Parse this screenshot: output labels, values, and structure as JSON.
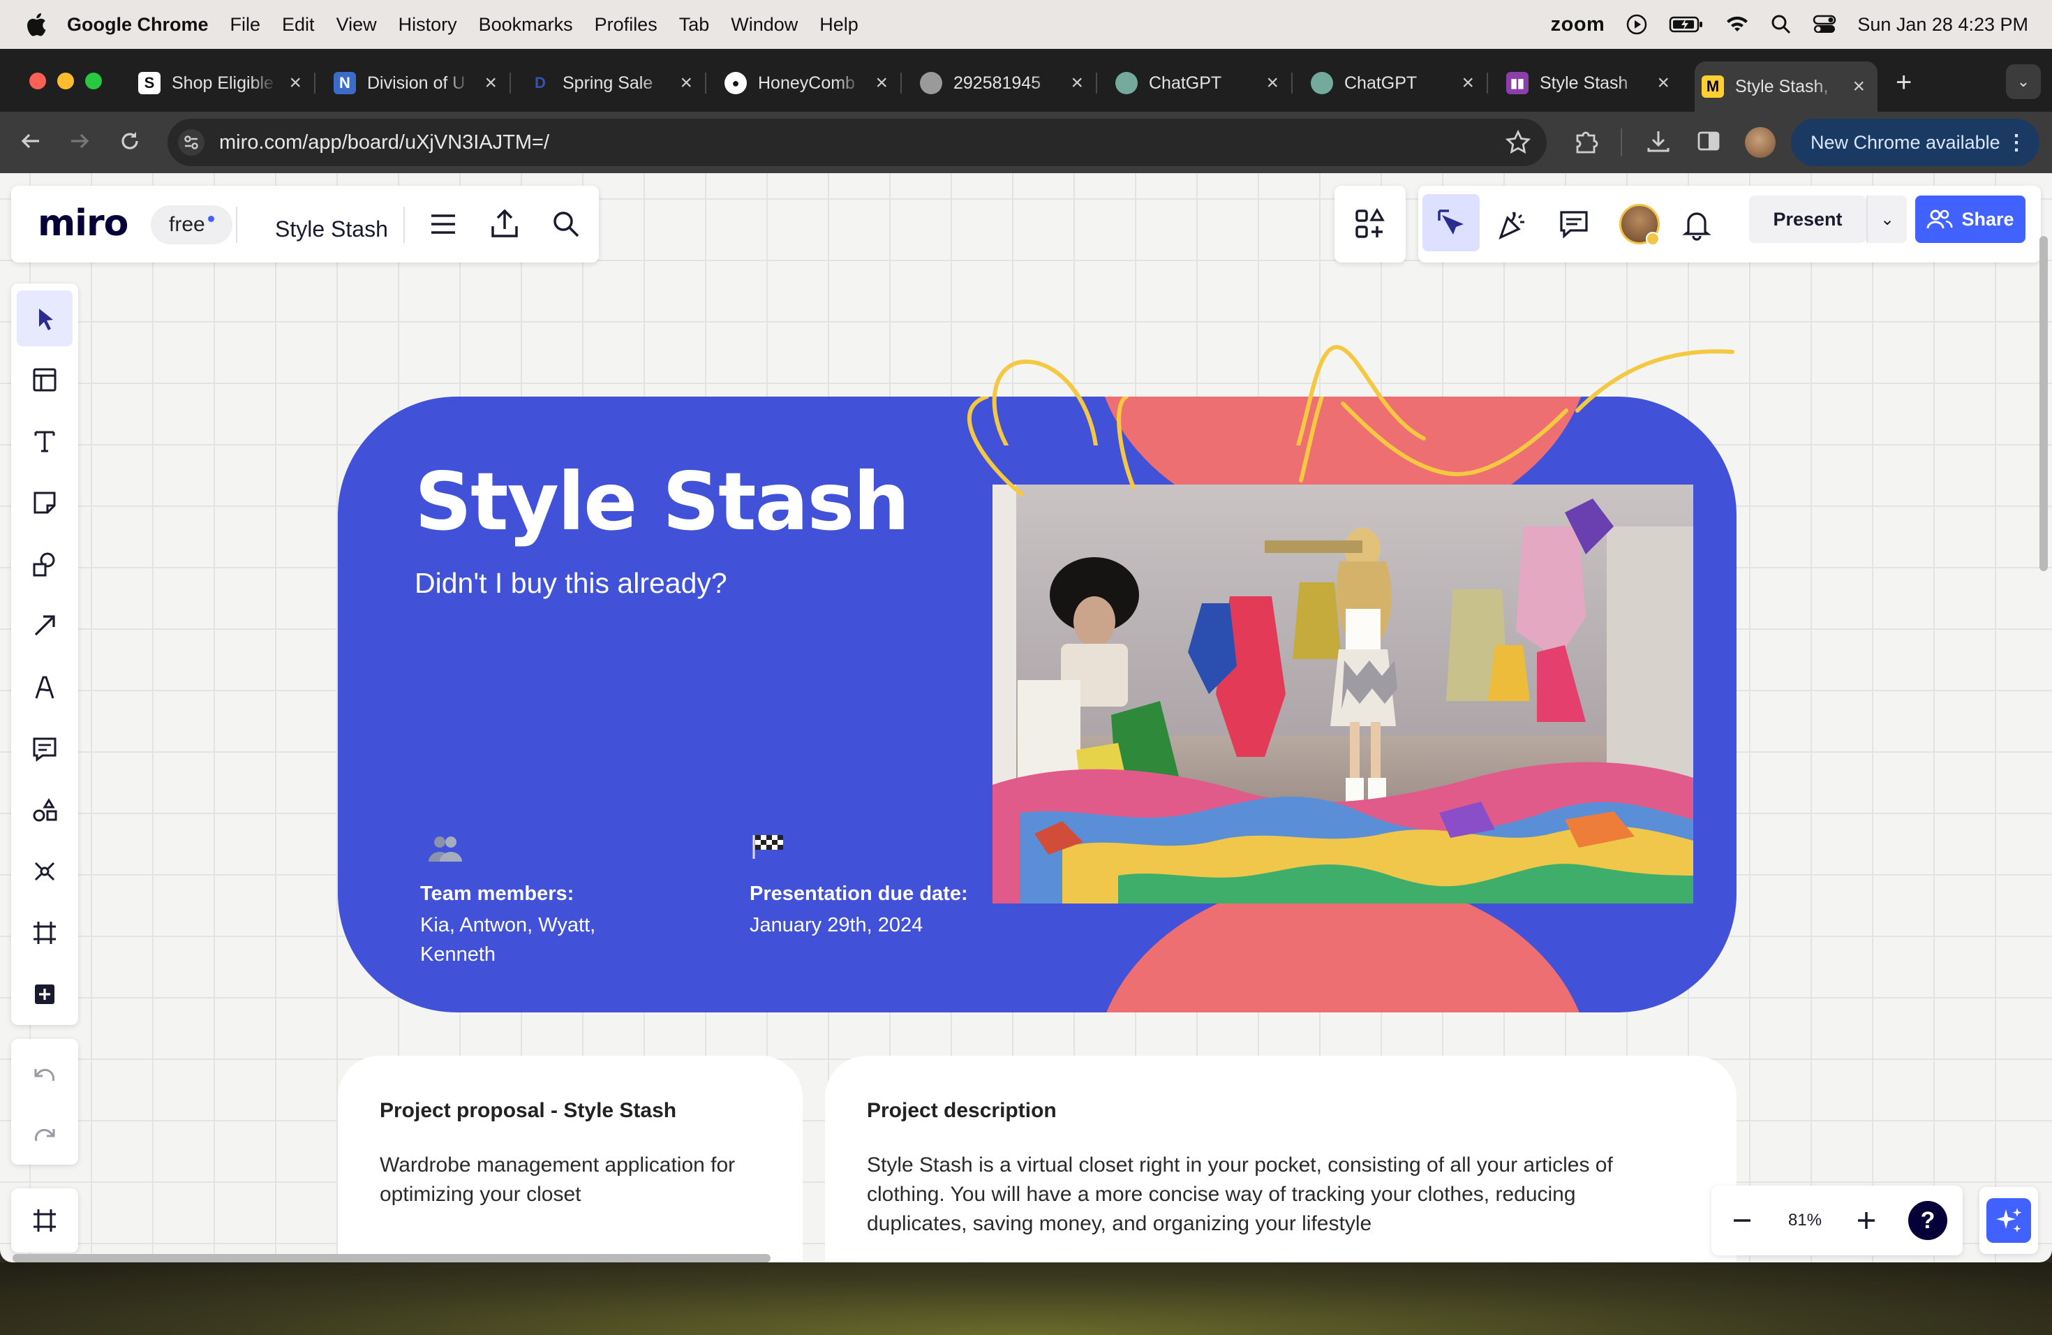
{
  "menubar": {
    "app_name": "Google Chrome",
    "items": [
      "File",
      "Edit",
      "View",
      "History",
      "Bookmarks",
      "Profiles",
      "Tab",
      "Window",
      "Help"
    ],
    "zoom_label": "zoom",
    "datetime": "Sun Jan 28  4:23 PM"
  },
  "browser": {
    "tabs": [
      {
        "title": "Shop Eligible",
        "favicon": "S",
        "color": "#ffffff"
      },
      {
        "title": "Division of U",
        "favicon": "N",
        "color": "#3b6cc8"
      },
      {
        "title": "Spring Sale",
        "favicon": "D",
        "color": "#1c3f8f"
      },
      {
        "title": "HoneyComb",
        "favicon": "gh",
        "color": "#ffffff"
      },
      {
        "title": "292581945",
        "favicon": "w",
        "color": "#9a9a9a"
      },
      {
        "title": "ChatGPT",
        "favicon": "ai",
        "color": "#74aa9c"
      },
      {
        "title": "ChatGPT",
        "favicon": "ai",
        "color": "#74aa9c"
      },
      {
        "title": "Style Stash",
        "favicon": "t",
        "color": "#8b3fa8"
      },
      {
        "title": "Style Stash,",
        "favicon": "m",
        "color": "#ffd02f"
      }
    ],
    "url": "miro.com/app/board/uXjVN3IAJTM=/",
    "update_button": "New Chrome available"
  },
  "miro": {
    "logo": "miro",
    "plan_badge": "free",
    "board_name": "Style Stash",
    "present_label": "Present",
    "share_label": "Share",
    "zoom_level": "81%",
    "help_label": "?",
    "accent_color": "#4262ff"
  },
  "frame": {
    "title": "Style Stash",
    "subtitle": "Didn't I buy this already?",
    "team_heading": "Team members:",
    "team_names": "Kia, Antwon, Wyatt, Kenneth",
    "due_heading": "Presentation due date:",
    "due_date": "January 29th, 2024",
    "bg_color": "#4252d8",
    "blob_color": "#ee6f72",
    "scribble_color": "#f5c842"
  },
  "cards": {
    "proposal_title": "Project proposal - Style Stash",
    "proposal_text": "Wardrobe management application for optimizing your closet",
    "description_title": "Project description",
    "description_text": "Style Stash is a virtual closet right in your pocket, consisting of all your articles of clothing.  You will have a more concise way of tracking your clothes, reducing duplicates, saving money, and organizing your lifestyle"
  }
}
